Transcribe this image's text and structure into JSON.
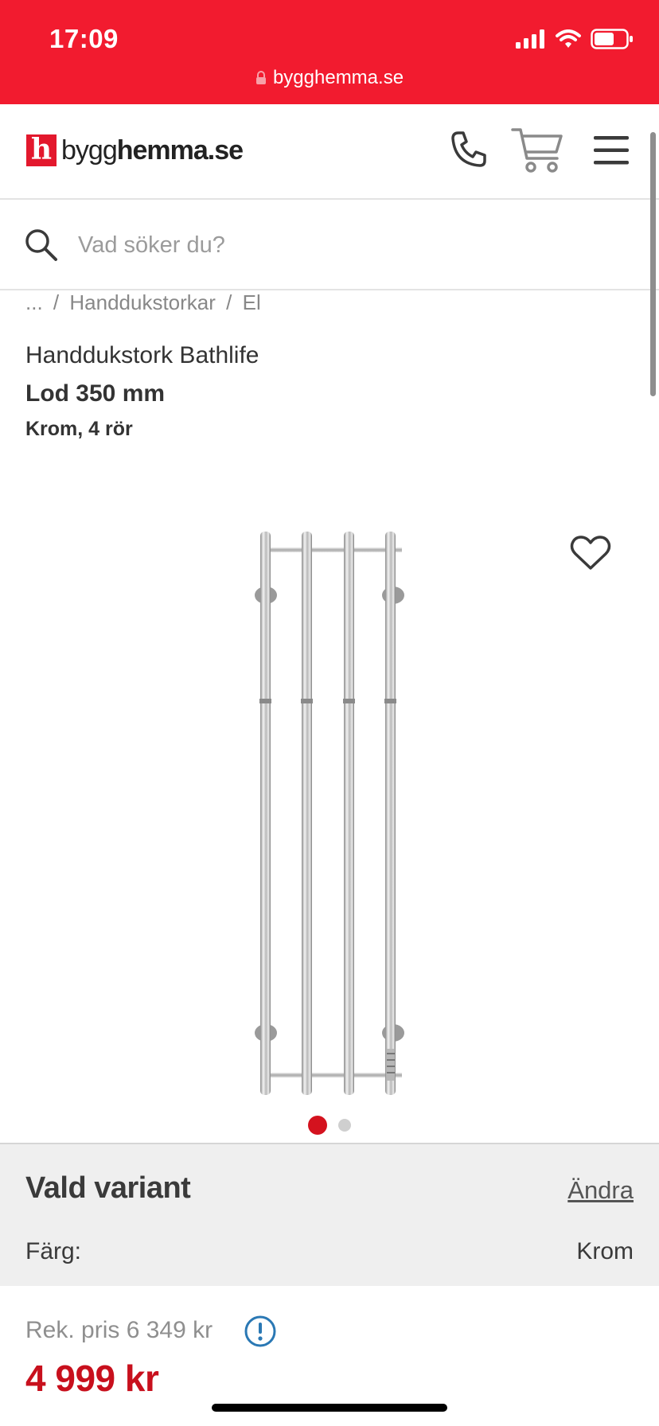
{
  "status_bar": {
    "time": "17:09",
    "url": "bygghemma.se",
    "background_color": "#f21b2f"
  },
  "header": {
    "logo_mark": "h",
    "logo_prefix": "bygg",
    "logo_suffix": "hemma.se",
    "icons": [
      "phone-icon",
      "cart-icon",
      "menu-icon"
    ]
  },
  "search": {
    "placeholder": "Vad söker du?",
    "value": ""
  },
  "breadcrumb": {
    "ellipsis": "...",
    "separator": "/",
    "items": [
      "Handdukstorkar",
      "El"
    ]
  },
  "product": {
    "title": "Handdukstork Bathlife",
    "subtitle": "Lod 350 mm",
    "variant": "Krom, 4 rör",
    "image_count": 2,
    "active_image": 1
  },
  "variant_panel": {
    "title": "Vald variant",
    "change_label": "Ändra",
    "color_label": "Färg:",
    "color_value": "Krom"
  },
  "pricing": {
    "recommended": "Rek. pris 6 349 kr",
    "price": "4 999 kr",
    "price_color": "#c8101d"
  }
}
